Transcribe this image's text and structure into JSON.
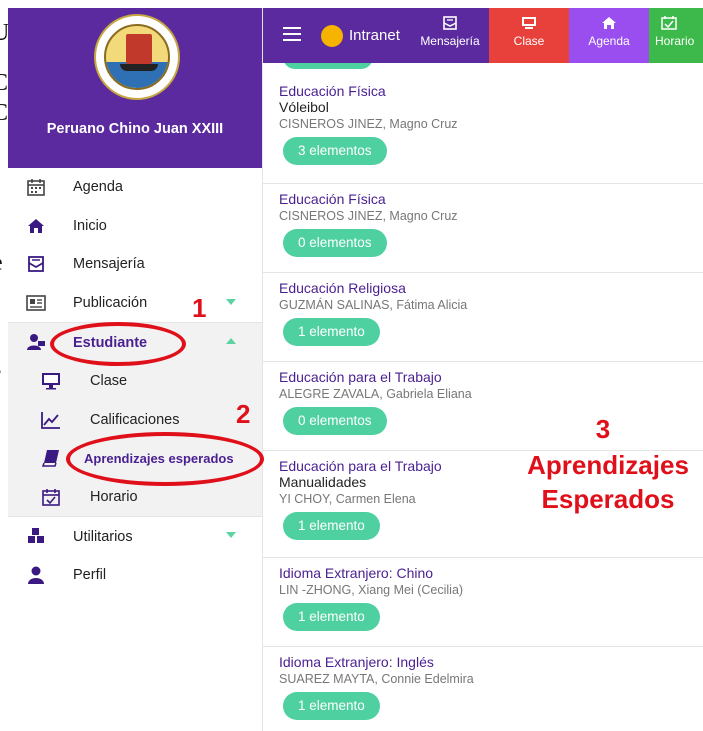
{
  "sidebar": {
    "school_name": "Peruano Chino Juan XXIII",
    "menu": [
      {
        "label": "Agenda"
      },
      {
        "label": "Inicio"
      },
      {
        "label": "Mensajería"
      },
      {
        "label": "Publicación"
      },
      {
        "label": "Estudiante"
      }
    ],
    "sub_menu": [
      {
        "label": "Clase"
      },
      {
        "label": "Calificaciones"
      },
      {
        "label": "Aprendizajes esperados"
      },
      {
        "label": "Horario"
      }
    ],
    "menu_bottom": [
      {
        "label": "Utilitarios"
      },
      {
        "label": "Perfil"
      }
    ]
  },
  "topbar": {
    "intranet": "Intranet",
    "tiles": [
      {
        "label": "Mensajería",
        "color": "#5b2a9e"
      },
      {
        "label": "Clase",
        "color": "#e8413b"
      },
      {
        "label": "Agenda",
        "color": "#9a4ef0"
      },
      {
        "label": "Horario",
        "color": "#3cb94a"
      }
    ]
  },
  "courses": [
    {
      "title": "Educación Física",
      "subtitle": "Vóleibol",
      "teacher": "CISNEROS JINEZ, Magno Cruz",
      "badge": "3 elementos"
    },
    {
      "title": "Educación Física",
      "subtitle": "",
      "teacher": "CISNEROS JINEZ, Magno Cruz",
      "badge": "0 elementos"
    },
    {
      "title": "Educación Religiosa",
      "subtitle": "",
      "teacher": "GUZMÁN SALINAS, Fátima Alicia",
      "badge": "1 elemento"
    },
    {
      "title": "Educación para el Trabajo",
      "subtitle": "",
      "teacher": "ALEGRE ZAVALA, Gabriela Eliana",
      "badge": "0 elementos"
    },
    {
      "title": "Educación para el Trabajo",
      "subtitle": "Manualidades",
      "teacher": "YI CHOY, Carmen Elena",
      "badge": "1 elemento"
    },
    {
      "title": "Idioma Extranjero: Chino",
      "subtitle": "",
      "teacher": "LIN -ZHONG, Xiang Mei (Cecilia)",
      "badge": "1 elemento"
    },
    {
      "title": "Idioma Extranjero: Inglés",
      "subtitle": "",
      "teacher": "SUAREZ MAYTA, Connie Edelmira",
      "badge": "1 elemento"
    }
  ],
  "annotations": {
    "n1": "1",
    "n2": "2",
    "n3": "3",
    "big_line1": "Aprendizajes",
    "big_line2": "Esperados"
  },
  "colors": {
    "accent": "#5b2a9e",
    "badge": "#4fd0a1",
    "annotation": "#e0101b"
  }
}
